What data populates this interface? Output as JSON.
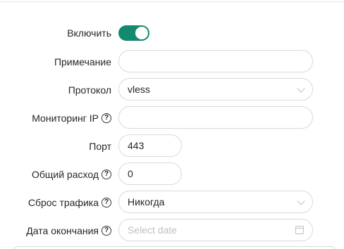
{
  "form": {
    "enable": {
      "label": "Включить",
      "value": true
    },
    "remark": {
      "label": "Примечание",
      "value": ""
    },
    "protocol": {
      "label": "Протокол",
      "value": "vless"
    },
    "monitor_ip": {
      "label": "Мониторинг IP",
      "value": ""
    },
    "port": {
      "label": "Порт",
      "value": "443"
    },
    "total_traffic": {
      "label": "Общий расход",
      "value": "0"
    },
    "traffic_reset": {
      "label": "Сброс трафика",
      "value": "Никогда"
    },
    "expiry_date": {
      "label": "Дата окончания",
      "placeholder": "Select date"
    }
  },
  "colors": {
    "toggle_on": "#138a6e"
  },
  "icons": [
    "help-icon",
    "chevron-down-icon",
    "calendar-icon"
  ]
}
